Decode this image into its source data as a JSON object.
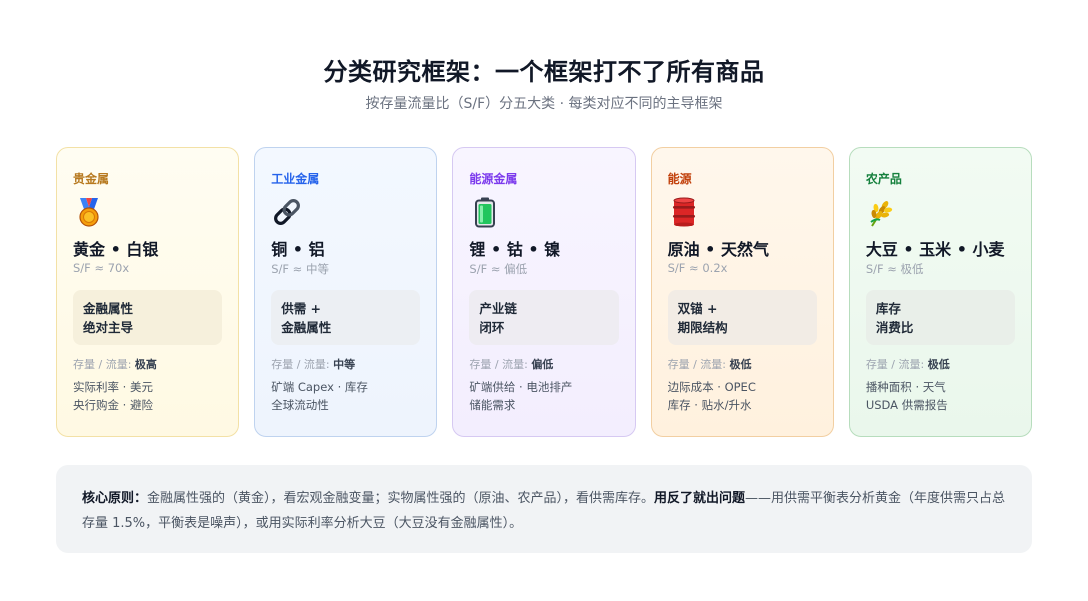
{
  "header": {
    "title": "分类研究框架：一个框架打不了所有商品",
    "subtitle": "按存量流量比（S/F）分五大类 · 每类对应不同的主导框架"
  },
  "cards": [
    {
      "category": "贵金属",
      "icon": "medal-icon",
      "items": "黄金 • 白银",
      "sf": "S/F ≈ 70x",
      "attr_line1": "金融属性",
      "attr_line2": "绝对主导",
      "ratio_label": "存量 / 流量:",
      "ratio_value": "极高",
      "driver_line1": "实际利率 · 美元",
      "driver_line2": "央行购金 · 避险",
      "accent": "#b7791f"
    },
    {
      "category": "工业金属",
      "icon": "chain-icon",
      "items": "铜 • 铝",
      "sf": "S/F ≈ 中等",
      "attr_line1": "供需 +",
      "attr_line2": "金融属性",
      "ratio_label": "存量 / 流量:",
      "ratio_value": "中等",
      "driver_line1": "矿端 Capex · 库存",
      "driver_line2": "全球流动性",
      "accent": "#2563eb"
    },
    {
      "category": "能源金属",
      "icon": "battery-icon",
      "items": "锂 • 钴 • 镍",
      "sf": "S/F ≈ 偏低",
      "attr_line1": "产业链",
      "attr_line2": "闭环",
      "ratio_label": "存量 / 流量:",
      "ratio_value": "偏低",
      "driver_line1": "矿端供给 · 电池排产",
      "driver_line2": "储能需求",
      "accent": "#7c3aed"
    },
    {
      "category": "能源",
      "icon": "oil-drum-icon",
      "items": "原油 • 天然气",
      "sf": "S/F ≈ 0.2x",
      "attr_line1": "双锚 +",
      "attr_line2": "期限结构",
      "ratio_label": "存量 / 流量:",
      "ratio_value": "极低",
      "driver_line1": "边际成本 · OPEC",
      "driver_line2": "库存 · 贴水/升水",
      "accent": "#c2410c"
    },
    {
      "category": "农产品",
      "icon": "wheat-icon",
      "items": "大豆 • 玉米 • 小麦",
      "sf": "S/F ≈ 极低",
      "attr_line1": "库存",
      "attr_line2": "消费比",
      "ratio_label": "存量 / 流量:",
      "ratio_value": "极低",
      "driver_line1": "播种面积 · 天气",
      "driver_line2": "USDA 供需报告",
      "accent": "#15803d"
    }
  ],
  "principle": {
    "label": "核心原则：",
    "text1": "金融属性强的（黄金），看宏观金融变量；实物属性强的（原油、农产品），看供需库存。",
    "emphasis": "用反了就出问题",
    "text2": "——用供需平衡表分析黄金（年度供需只占总存量 1.5%，平衡表是噪声），或用实际利率分析大豆（大豆没有金融属性）。"
  }
}
